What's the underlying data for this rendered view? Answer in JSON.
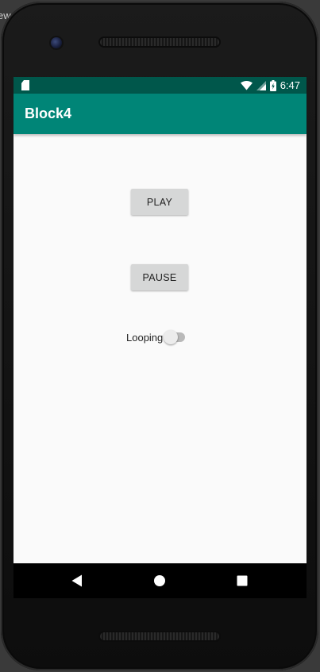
{
  "backdrop": {
    "text": "ew"
  },
  "status_bar": {
    "time": "6:47",
    "icons": [
      "sd-card-icon",
      "wifi-icon",
      "signal-icon",
      "battery-icon"
    ]
  },
  "app_bar": {
    "title": "Block4"
  },
  "main": {
    "play_label": "PLAY",
    "pause_label": "PAUSE",
    "looping": {
      "label": "Looping",
      "checked": false
    }
  },
  "nav_bar": {
    "icons": [
      "back-icon",
      "home-icon",
      "recents-icon"
    ]
  },
  "colors": {
    "status_bar": "#00574b",
    "app_bar": "#008577",
    "background": "#fafafa",
    "button": "#d6d7d7"
  }
}
